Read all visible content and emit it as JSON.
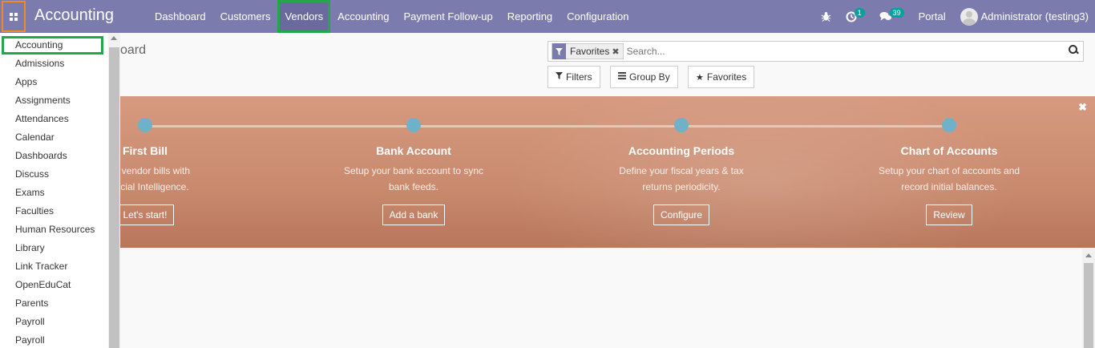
{
  "navbar": {
    "brand": "Accounting",
    "menu": [
      "Dashboard",
      "Customers",
      "Vendors",
      "Accounting",
      "Payment Follow-up",
      "Reporting",
      "Configuration"
    ],
    "activity_count": "1",
    "messages_count": "39",
    "portal_label": "Portal",
    "user_label": "Administrator (testing3)"
  },
  "app_menu": {
    "items": [
      "Accounting",
      "Admissions",
      "Apps",
      "Assignments",
      "Attendances",
      "Calendar",
      "Dashboards",
      "Discuss",
      "Exams",
      "Faculties",
      "Human Resources",
      "Library",
      "Link Tracker",
      "OpenEduCat",
      "Parents",
      "Payroll",
      "Payroll"
    ]
  },
  "control_panel": {
    "breadcrumb": "oard",
    "facet_label": "Favorites",
    "search_placeholder": "Search...",
    "filters_label": "Filters",
    "groupby_label": "Group By",
    "favorites_label": "Favorites"
  },
  "onboarding": {
    "steps": [
      {
        "title": "First Bill",
        "desc1": "your vendor bills with",
        "desc2": "Artificial Intelligence.",
        "button": "Let's start!"
      },
      {
        "title": "Bank Account",
        "desc1": "Setup your bank account to sync",
        "desc2": "bank feeds.",
        "button": "Add a bank"
      },
      {
        "title": "Accounting Periods",
        "desc1": "Define your fiscal years & tax",
        "desc2": "returns periodicity.",
        "button": "Configure"
      },
      {
        "title": "Chart of Accounts",
        "desc1": "Setup your chart of accounts and",
        "desc2": "record initial balances.",
        "button": "Review"
      }
    ]
  },
  "colors": {
    "navbar": "#7c7bad",
    "highlight_orange": "#f08a24",
    "highlight_green": "#22a84a",
    "banner": "#c98a6e",
    "timeline_dot": "#6fb1c8",
    "badge": "#00a09d"
  }
}
